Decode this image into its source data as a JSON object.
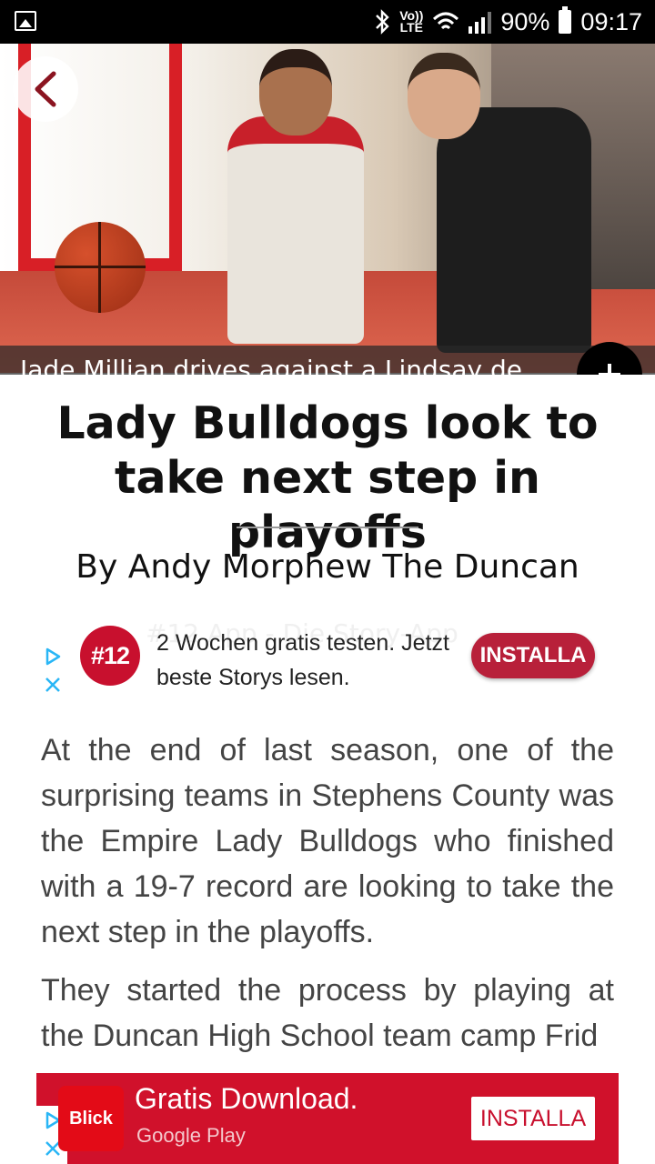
{
  "status_bar": {
    "volte_top": "Vo))",
    "volte_bottom": "LTE",
    "battery": "90%",
    "time": "09:17",
    "icons": [
      "gallery-icon",
      "bluetooth-icon",
      "wifi-icon",
      "signal-icon",
      "battery-icon"
    ]
  },
  "hero": {
    "caption": "Jade Millian drives against a Lindsay de",
    "back_icon": "chevron-left-icon",
    "plus_icon": "plus-icon"
  },
  "article": {
    "headline": "Lady Bulldogs look to take next step in playoffs",
    "byline": "By Andy Morphew The Duncan",
    "paragraphs": [
      "At the end of last season, one of the surprising teams in Stephens County was the Empire Lady Bulldogs who finished with a 19-7 record are looking to take the next step in the playoffs.",
      "They started the process by playing at the Duncan High School team camp Frid"
    ]
  },
  "ad_middle": {
    "ghost_text": "#12 App - Die Story-App",
    "badge": "#12",
    "text": "2 Wochen gratis testen. Jetzt beste Storys lesen.",
    "install": "INSTALLA"
  },
  "ad_bottom": {
    "logo": "Blick",
    "title": "Gratis Download.",
    "store": "Google Play",
    "install": "INSTALLA"
  },
  "colors": {
    "accent_red": "#c8102e",
    "install_pill": "#b8203a",
    "ad_banner": "#d0112b",
    "adchoice_blue": "#29b6f6"
  }
}
